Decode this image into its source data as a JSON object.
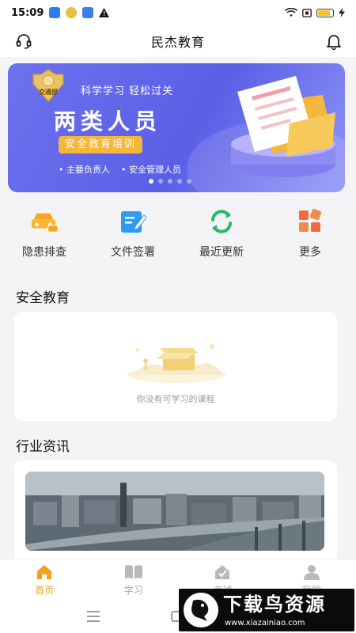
{
  "status_bar": {
    "time": "15:09",
    "icons": [
      "baidu-app-icon",
      "wechat-app-icon",
      "app-notification-icon",
      "warning-icon"
    ],
    "right_icons": [
      "wifi-icon",
      "sim-icon",
      "battery-icon",
      "charging-icon"
    ],
    "battery_level": 0.85
  },
  "header": {
    "title": "民杰教育",
    "left_icon": "headset-icon",
    "right_icon": "bell-icon"
  },
  "banner": {
    "seal_text": "交通部",
    "slogan": "科学学习 轻松过关",
    "headline": "两类人员",
    "chip": "安全教育培训",
    "points": [
      "• 主要负责人",
      "• 安全管理人员"
    ],
    "slide_count": 5,
    "active_slide": 1
  },
  "quick_actions": [
    {
      "label": "隐患排查",
      "icon": "car-inspect-icon"
    },
    {
      "label": "文件签署",
      "icon": "document-sign-icon"
    },
    {
      "label": "最近更新",
      "icon": "refresh-icon"
    },
    {
      "label": "更多",
      "icon": "more-grid-icon"
    }
  ],
  "safety_section": {
    "title": "安全教育",
    "empty_text": "你没有可学习的课程"
  },
  "news_section": {
    "title": "行业资讯"
  },
  "tab_bar": [
    {
      "label": "首页",
      "icon": "home-icon",
      "active": true
    },
    {
      "label": "学习",
      "icon": "book-icon",
      "active": false
    },
    {
      "label": "考试",
      "icon": "exam-icon",
      "active": false
    },
    {
      "label": "我的",
      "icon": "user-icon",
      "active": false
    }
  ],
  "watermark": {
    "title": "下载鸟资源",
    "url": "www.xiazainiao.com"
  },
  "colors": {
    "accent": "#f2a31b",
    "banner": "#6065e8",
    "chip": "#f4b63c"
  }
}
